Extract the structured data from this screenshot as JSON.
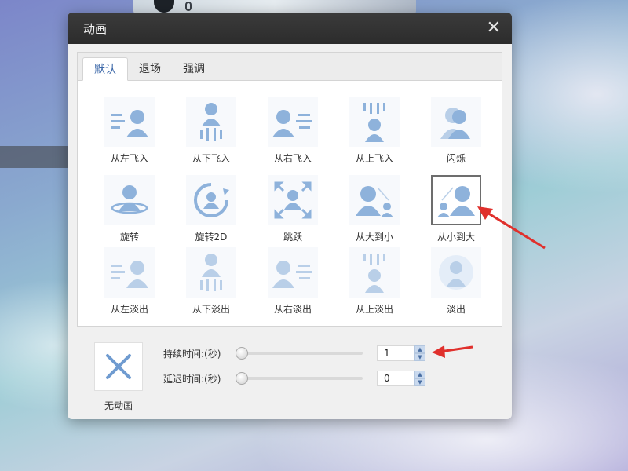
{
  "dialog": {
    "title": "动画",
    "close_glyph": "✕"
  },
  "tabs": [
    {
      "label": "默认",
      "active": true
    },
    {
      "label": "退场",
      "active": false
    },
    {
      "label": "强调",
      "active": false
    }
  ],
  "effects": [
    {
      "label": "从左飞入",
      "icon": "fly-from-left-icon"
    },
    {
      "label": "从下飞入",
      "icon": "fly-from-bottom-icon"
    },
    {
      "label": "从右飞入",
      "icon": "fly-from-right-icon"
    },
    {
      "label": "从上飞入",
      "icon": "fly-from-top-icon"
    },
    {
      "label": "闪烁",
      "icon": "flash-icon"
    },
    {
      "label": "旋转",
      "icon": "rotate-icon"
    },
    {
      "label": "旋转2D",
      "icon": "rotate-2d-icon"
    },
    {
      "label": "跳跃",
      "icon": "jump-icon"
    },
    {
      "label": "从大到小",
      "icon": "large-to-small-icon"
    },
    {
      "label": "从小到大",
      "icon": "small-to-large-icon",
      "selected": true
    },
    {
      "label": "从左淡出",
      "icon": "fade-from-left-icon"
    },
    {
      "label": "从下淡出",
      "icon": "fade-from-bottom-icon"
    },
    {
      "label": "从右淡出",
      "icon": "fade-from-right-icon"
    },
    {
      "label": "从上淡出",
      "icon": "fade-from-top-icon"
    },
    {
      "label": "淡出",
      "icon": "fade-out-icon"
    }
  ],
  "no_animation": {
    "label": "无动画",
    "icon": "close-x-icon"
  },
  "duration": {
    "label": "持续时间:(秒)",
    "value": "1"
  },
  "delay": {
    "label": "延迟时间:(秒)",
    "value": "0"
  },
  "spin_up_glyph": "▲",
  "spin_down_glyph": "▼",
  "colors": {
    "accent": "#3b67a8",
    "icon_blue": "#8eb2db",
    "annotation_red": "#e0302c"
  }
}
